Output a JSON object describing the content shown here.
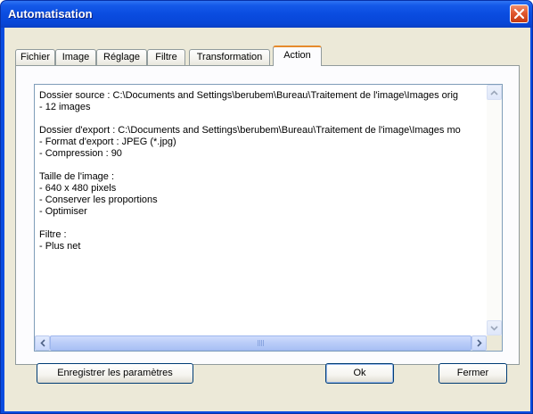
{
  "window": {
    "title": "Automatisation"
  },
  "tabs": [
    {
      "label": "Fichier",
      "active": false
    },
    {
      "label": "Image",
      "active": false
    },
    {
      "label": "Réglage",
      "active": false
    },
    {
      "label": "Filtre",
      "active": false
    },
    {
      "label": "Transformation",
      "active": false
    },
    {
      "label": "Action",
      "active": true
    }
  ],
  "summary": {
    "lines": [
      "Dossier source : C:\\Documents and Settings\\berubem\\Bureau\\Traitement de l'image\\Images orig",
      "- 12 images",
      "",
      "Dossier d'export : C:\\Documents and Settings\\berubem\\Bureau\\Traitement de l'image\\Images mo",
      "- Format d'export : JPEG (*.jpg)",
      "- Compression : 90",
      "",
      "Taille de l'image :",
      "- 640 x 480 pixels",
      "- Conserver les proportions",
      "- Optimiser",
      "",
      "Filtre :",
      "- Plus net"
    ]
  },
  "buttons": {
    "save": "Enregistrer les paramètres",
    "ok": "Ok",
    "close": "Fermer"
  },
  "colors": {
    "titlebar": "#0a4ce0",
    "dialog_bg": "#ece9d8",
    "active_tab_accent": "#e68b2c"
  }
}
